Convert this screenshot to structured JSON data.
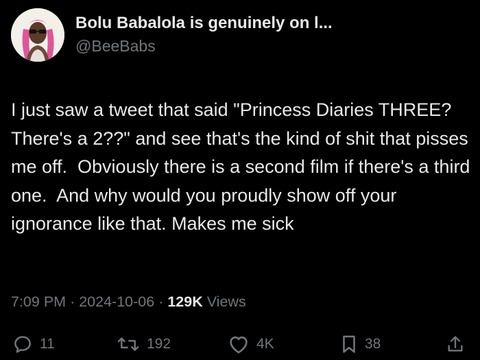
{
  "author": {
    "display_name": "Bolu Babalola is genuinely on l...",
    "handle": "@BeeBabs",
    "avatar_icon": "profile-photo"
  },
  "tweet": {
    "text": "I just saw a tweet that said \"Princess Diaries THREE? There's a 2??\" and see that's the kind of shit that pisses me off.  Obviously there is a second film if there's a third one.  And why would you proudly show off your ignorance like that. Makes me sick"
  },
  "meta": {
    "time": "7:09 PM",
    "separator": "·",
    "date": "2024-10-06",
    "views_count": "129K",
    "views_label": "Views"
  },
  "actions": {
    "reply": {
      "icon": "reply-icon",
      "count": "11"
    },
    "retweet": {
      "icon": "retweet-icon",
      "count": "192"
    },
    "like": {
      "icon": "heart-icon",
      "count": "4K"
    },
    "bookmark": {
      "icon": "bookmark-icon",
      "count": "38"
    },
    "share": {
      "icon": "share-icon"
    }
  },
  "colors": {
    "background": "#000000",
    "primary_text": "#e7e9ea",
    "secondary_text": "#71767b"
  }
}
